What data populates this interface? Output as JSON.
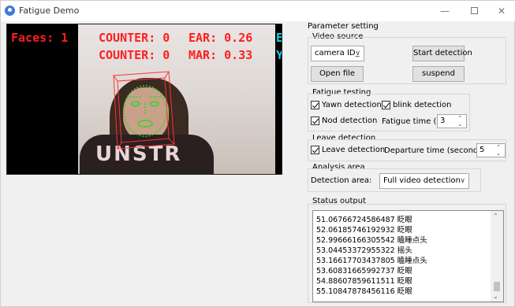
{
  "window": {
    "title": "Fatigue Demo",
    "minimize_symbol": "—",
    "close_symbol": "✕",
    "app_icon": "app-icon"
  },
  "video": {
    "faces_text": "Faces: 1",
    "counter1_text": "COUNTER: 0",
    "ear_text": "EAR: 0.26",
    "counter2_text": "COUNTER: 0",
    "mar_text": "MAR: 0.33",
    "clip1_text": "E",
    "clip2_text": "Y",
    "shirt_text": "UNSTR"
  },
  "panel": {
    "title": "Parameter setting",
    "video_source": {
      "label": "Video source",
      "camera_combo_value": "camera ID_",
      "start_button": "Start detection",
      "open_file_button": "Open file",
      "suspend_button": "suspend"
    },
    "fatigue_testing": {
      "label": "Fatigue testing",
      "yawn_label": "Yawn detection",
      "blink_label": "blink detection",
      "nod_label": "Nod detection",
      "fatigue_time_label": "Fatigue time (s):",
      "fatigue_time_value": "3"
    },
    "leave_detection": {
      "label": "Leave detection",
      "leave_label": "Leave detection",
      "departure_label": "Departure time (seconds):",
      "departure_value": "5"
    },
    "analysis_area": {
      "label": "Analysis area",
      "detection_area_label": "Detection area:",
      "detection_area_value": "Full video detection"
    },
    "status_output": {
      "label": "Status output",
      "lines": [
        "51.06766724586487 眨眼",
        "52.06185746192932 眨眼",
        "52.99666166305542 瞌睡点头",
        "53.04453372955322 摇头",
        "53.16617703437805 瞌睡点头",
        "53.60831665992737 眨眼",
        "54.88607859611511 眨眼",
        "55.10847878456116 眨眼"
      ]
    }
  },
  "colors": {
    "overlay_red": "#ff1f1f",
    "overlay_cyan": "#15d3e6",
    "landmark_green": "#22dd22"
  }
}
